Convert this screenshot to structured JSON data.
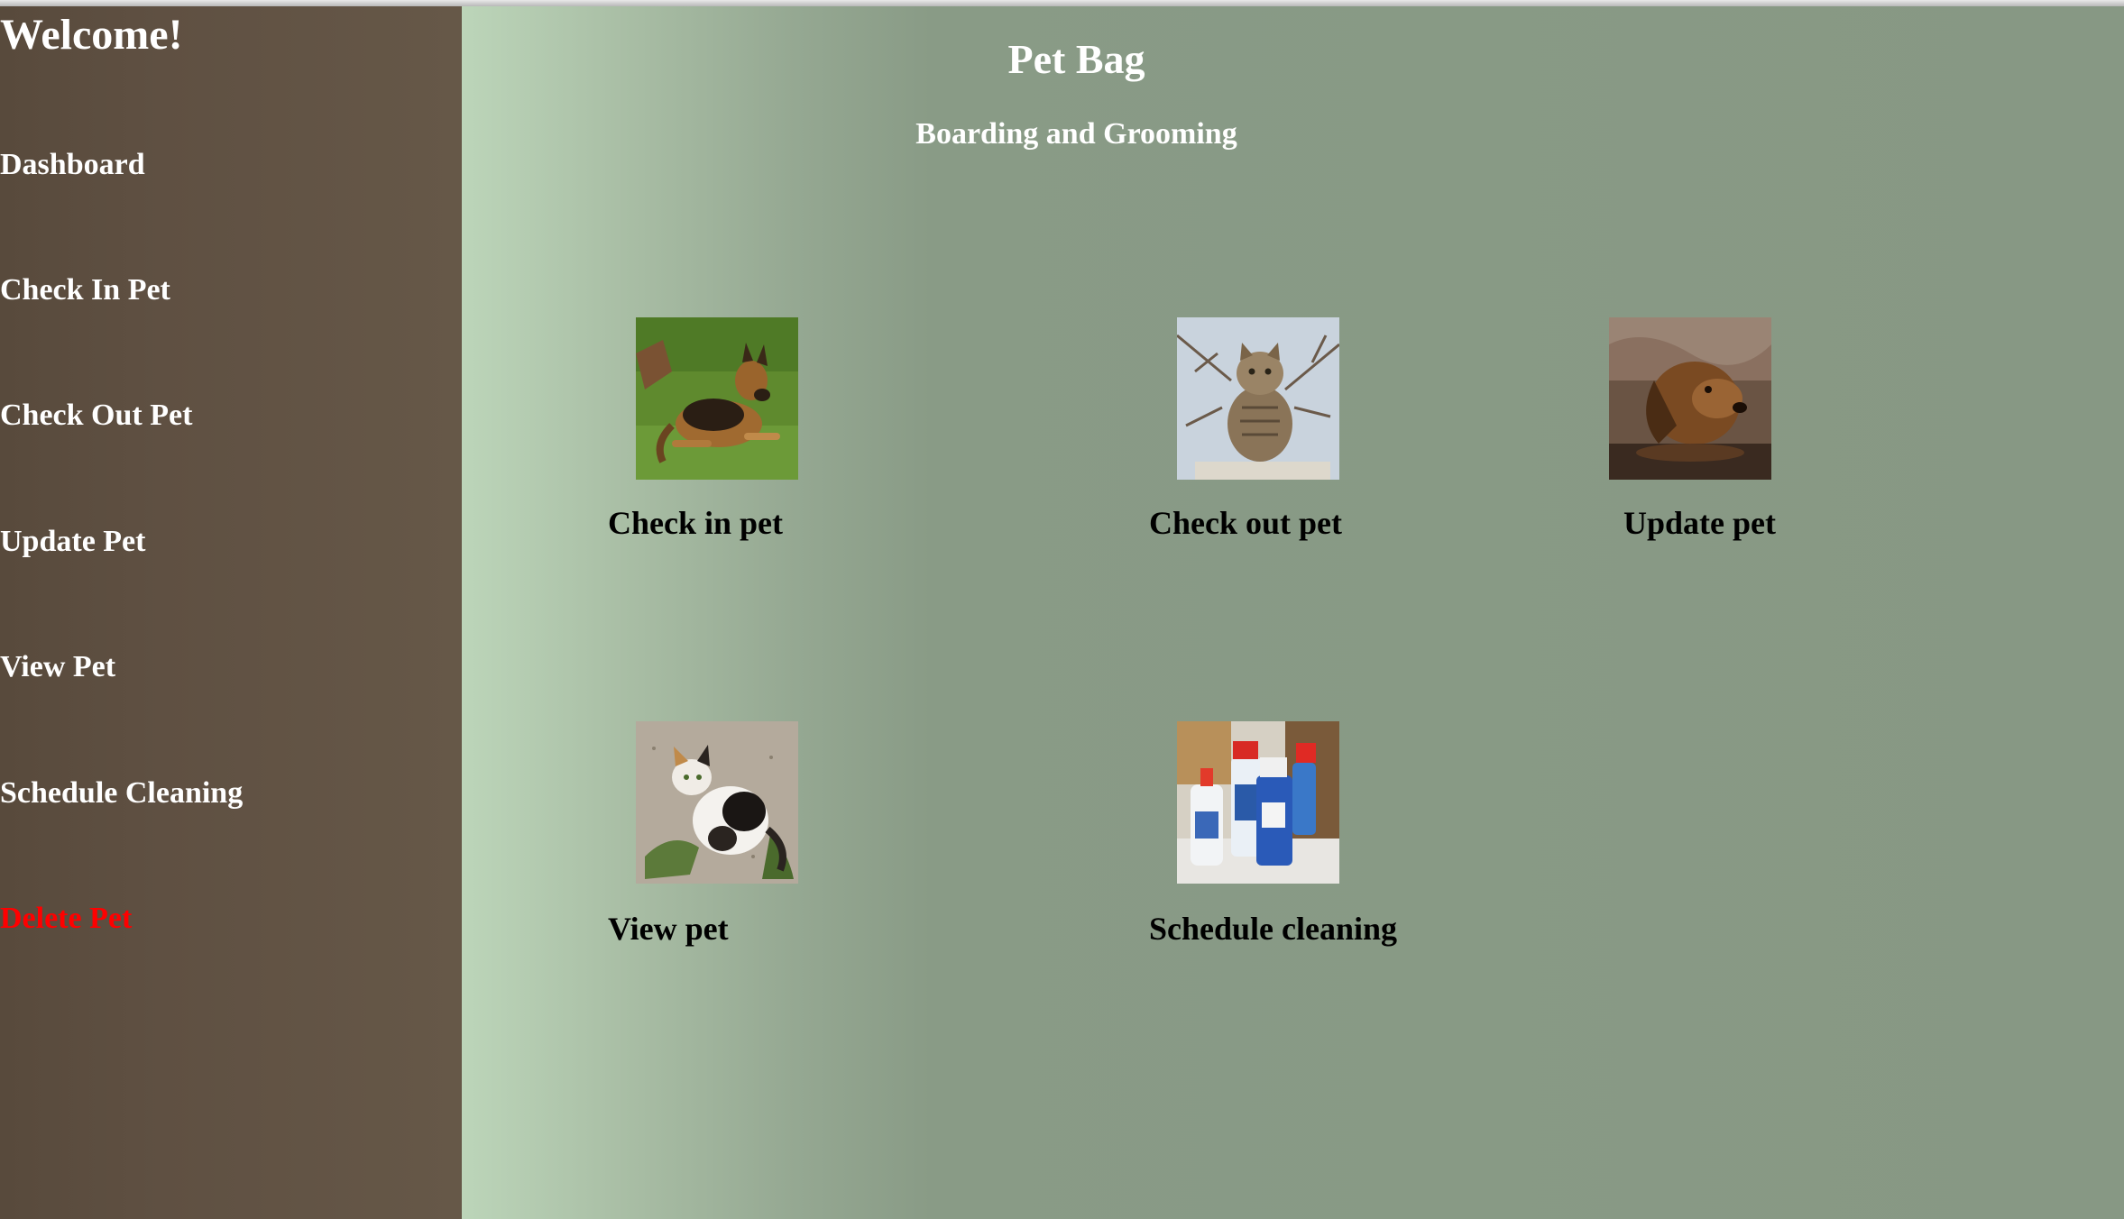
{
  "sidebar": {
    "welcome": "Welcome!",
    "items": [
      {
        "label": "Dashboard"
      },
      {
        "label": "Check In Pet"
      },
      {
        "label": "Check Out Pet"
      },
      {
        "label": "Update Pet"
      },
      {
        "label": "View Pet"
      },
      {
        "label": "Schedule Cleaning"
      },
      {
        "label": "Delete Pet"
      }
    ],
    "danger_color": "#ff0000"
  },
  "header": {
    "title": "Pet Bag",
    "subtitle": "Boarding and Grooming"
  },
  "tiles": [
    {
      "label": "Check in pet",
      "image": "german-shepherd-photo"
    },
    {
      "label": "Check out pet",
      "image": "tabby-cat-photo"
    },
    {
      "label": "Update pet",
      "image": "wet-dog-photo"
    },
    {
      "label": "View pet",
      "image": "calico-cat-photo"
    },
    {
      "label": "Schedule cleaning",
      "image": "cleaning-supplies-photo"
    }
  ]
}
